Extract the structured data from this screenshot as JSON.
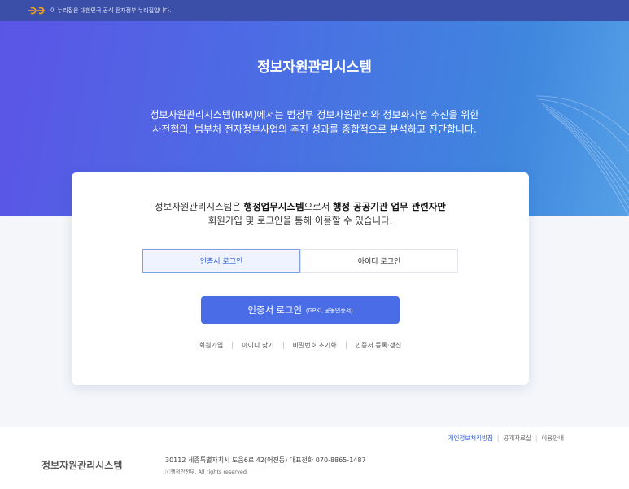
{
  "gov_bar": {
    "text": "이 누리집은 대한민국 공식 전자정부 누리집입니다.",
    "logo_icon": "eg-logo-icon"
  },
  "hero": {
    "title": "정보자원관리시스템",
    "desc_line1": "정보자원관리시스템(IRM)에서는 범정부 정보자원관리와 정보화사업 추진을 위한",
    "desc_line2": "사전협의, 범부처 전자정부사업의 추진 성과를 종합적으로 분석하고 진단합니다."
  },
  "card": {
    "notice_part1": "정보자원관리시스템은 ",
    "notice_bold1": "행정업무시스템",
    "notice_part2": "으로서 ",
    "notice_bold2": "행정 공공기관 업무 관련자만",
    "notice_line2": "회원가입 및 로그인을 통해 이용할 수 있습니다.",
    "tabs": [
      {
        "label": "인증서 로그인",
        "active": true
      },
      {
        "label": "아이디 로그인",
        "active": false
      }
    ],
    "login_button": {
      "main": "인증서 로그인",
      "sub": "(GPKI, 공동인증서)"
    },
    "links": [
      "회원가입",
      "아이디 찾기",
      "비밀번호 초기화",
      "인증서 등록·갱신"
    ]
  },
  "footer": {
    "links": [
      "개인정보처리방침",
      "공개자료실",
      "이용안내"
    ],
    "brand": "정보자원관리시스템",
    "address": "30112 세종특별자치시 도움6로 42(어진동) 대표전화 070-8865-1487",
    "copyright": "ⓒ행정안전부. All rights reserved."
  },
  "colors": {
    "primary": "#4a6ce6",
    "hero_start": "#5b55e6",
    "hero_end": "#56a0e6",
    "gov_bar": "#3b4fa8"
  }
}
